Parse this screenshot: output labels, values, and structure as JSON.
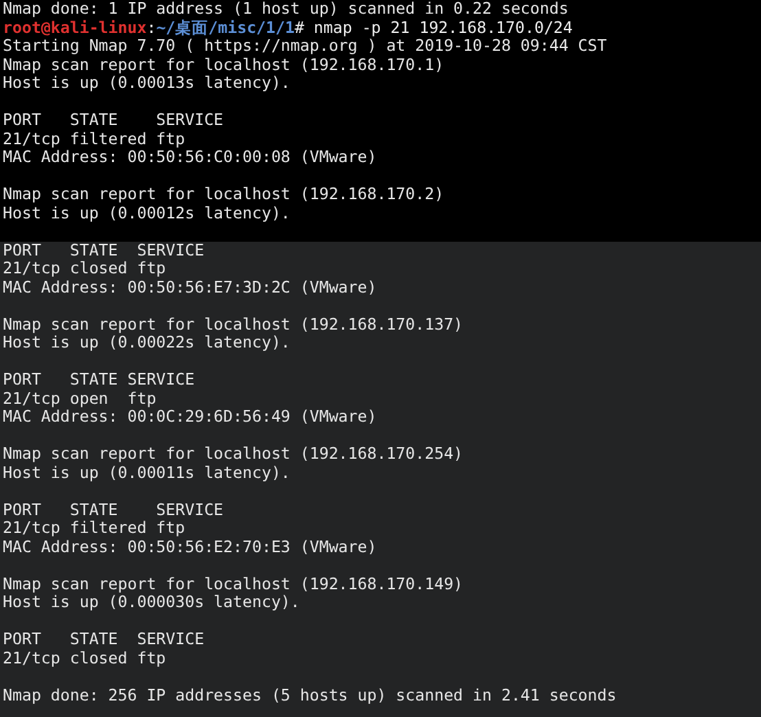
{
  "terminal": {
    "lines": [
      {
        "kind": "output",
        "text": "Nmap done: 1 IP address (1 host up) scanned in 0.22 seconds"
      },
      {
        "kind": "prompt",
        "user": "root@kali-linux",
        "separator": ":",
        "path": "~/桌面/misc/1/1",
        "command": "# nmap -p 21 192.168.170.0/24"
      },
      {
        "kind": "output",
        "text": "Starting Nmap 7.70 ( https://nmap.org ) at 2019-10-28 09:44 CST"
      },
      {
        "kind": "output",
        "text": "Nmap scan report for localhost (192.168.170.1)"
      },
      {
        "kind": "output",
        "text": "Host is up (0.00013s latency)."
      },
      {
        "kind": "blank"
      },
      {
        "kind": "output",
        "text": "PORT   STATE    SERVICE"
      },
      {
        "kind": "output",
        "text": "21/tcp filtered ftp"
      },
      {
        "kind": "output",
        "text": "MAC Address: 00:50:56:C0:00:08 (VMware)"
      },
      {
        "kind": "blank"
      },
      {
        "kind": "output",
        "text": "Nmap scan report for localhost (192.168.170.2)"
      },
      {
        "kind": "output",
        "text": "Host is up (0.00012s latency)."
      },
      {
        "kind": "blank"
      },
      {
        "kind": "output",
        "text": "PORT   STATE  SERVICE"
      },
      {
        "kind": "output",
        "text": "21/tcp closed ftp"
      },
      {
        "kind": "output",
        "text": "MAC Address: 00:50:56:E7:3D:2C (VMware)"
      },
      {
        "kind": "blank"
      },
      {
        "kind": "output",
        "text": "Nmap scan report for localhost (192.168.170.137)"
      },
      {
        "kind": "output",
        "text": "Host is up (0.00022s latency)."
      },
      {
        "kind": "blank"
      },
      {
        "kind": "output",
        "text": "PORT   STATE SERVICE"
      },
      {
        "kind": "output",
        "text": "21/tcp open  ftp"
      },
      {
        "kind": "output",
        "text": "MAC Address: 00:0C:29:6D:56:49 (VMware)"
      },
      {
        "kind": "blank"
      },
      {
        "kind": "output",
        "text": "Nmap scan report for localhost (192.168.170.254)"
      },
      {
        "kind": "output",
        "text": "Host is up (0.00011s latency)."
      },
      {
        "kind": "blank"
      },
      {
        "kind": "output",
        "text": "PORT   STATE    SERVICE"
      },
      {
        "kind": "output",
        "text": "21/tcp filtered ftp"
      },
      {
        "kind": "output",
        "text": "MAC Address: 00:50:56:E2:70:E3 (VMware)"
      },
      {
        "kind": "blank"
      },
      {
        "kind": "output",
        "text": "Nmap scan report for localhost (192.168.170.149)"
      },
      {
        "kind": "output",
        "text": "Host is up (0.000030s latency)."
      },
      {
        "kind": "blank"
      },
      {
        "kind": "output",
        "text": "PORT   STATE  SERVICE"
      },
      {
        "kind": "output",
        "text": "21/tcp closed ftp"
      },
      {
        "kind": "blank"
      },
      {
        "kind": "output",
        "text": "Nmap done: 256 IP addresses (5 hosts up) scanned in 2.41 seconds"
      }
    ]
  }
}
